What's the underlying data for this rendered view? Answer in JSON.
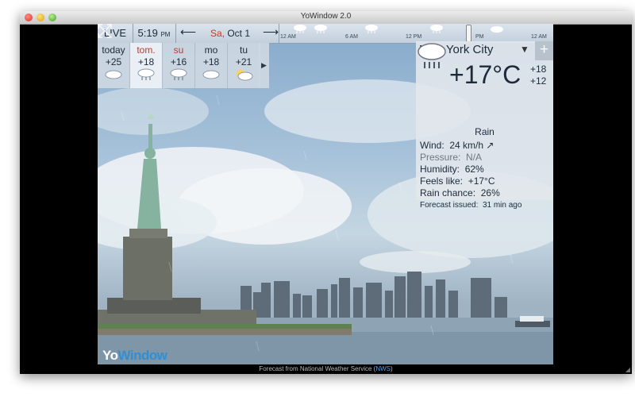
{
  "window": {
    "title": "YoWindow 2.0"
  },
  "topbar": {
    "live_label": "LIVE",
    "time": "5:19",
    "time_ampm": "PM",
    "date_dow": "Sa,",
    "date_rest": " Oct 1",
    "timeline_labels": [
      "12 AM",
      "6 AM",
      "12 PM",
      "PM",
      "12 AM"
    ]
  },
  "forecast_days": [
    {
      "name": "today",
      "temp": "+25",
      "icon": "cloud-icon"
    },
    {
      "name": "tom.",
      "temp": "+18",
      "icon": "rain-cloud-icon"
    },
    {
      "name": "su",
      "temp": "+16",
      "icon": "rain-cloud-icon"
    },
    {
      "name": "mo",
      "temp": "+18",
      "icon": "cloud-icon"
    },
    {
      "name": "tu",
      "temp": "+21",
      "icon": "partly-sunny-icon"
    }
  ],
  "panel": {
    "city": "New York City",
    "current_temp": "+17°C",
    "high": "+18",
    "low": "+12",
    "condition": "Rain",
    "wind_label": "Wind:",
    "wind_value": "24 km/h ↗",
    "pressure_label": "Pressure:",
    "pressure_value": "N/A",
    "humidity_label": "Humidity:",
    "humidity_value": "62%",
    "feels_label": "Feels like:",
    "feels_value": "+17°C",
    "rain_label": "Rain chance:",
    "rain_value": "26%",
    "issued_label": "Forecast issued:",
    "issued_value": "31 min ago"
  },
  "logo": {
    "part1": "Yo",
    "part2": "Window"
  },
  "footer": {
    "text": "Forecast from National Weather Service (",
    "link": "NWS",
    "end": ")"
  },
  "colors": {
    "accent_red": "#c0392b",
    "logo_blue": "#2f8fd6",
    "sky": "#86aacb"
  }
}
